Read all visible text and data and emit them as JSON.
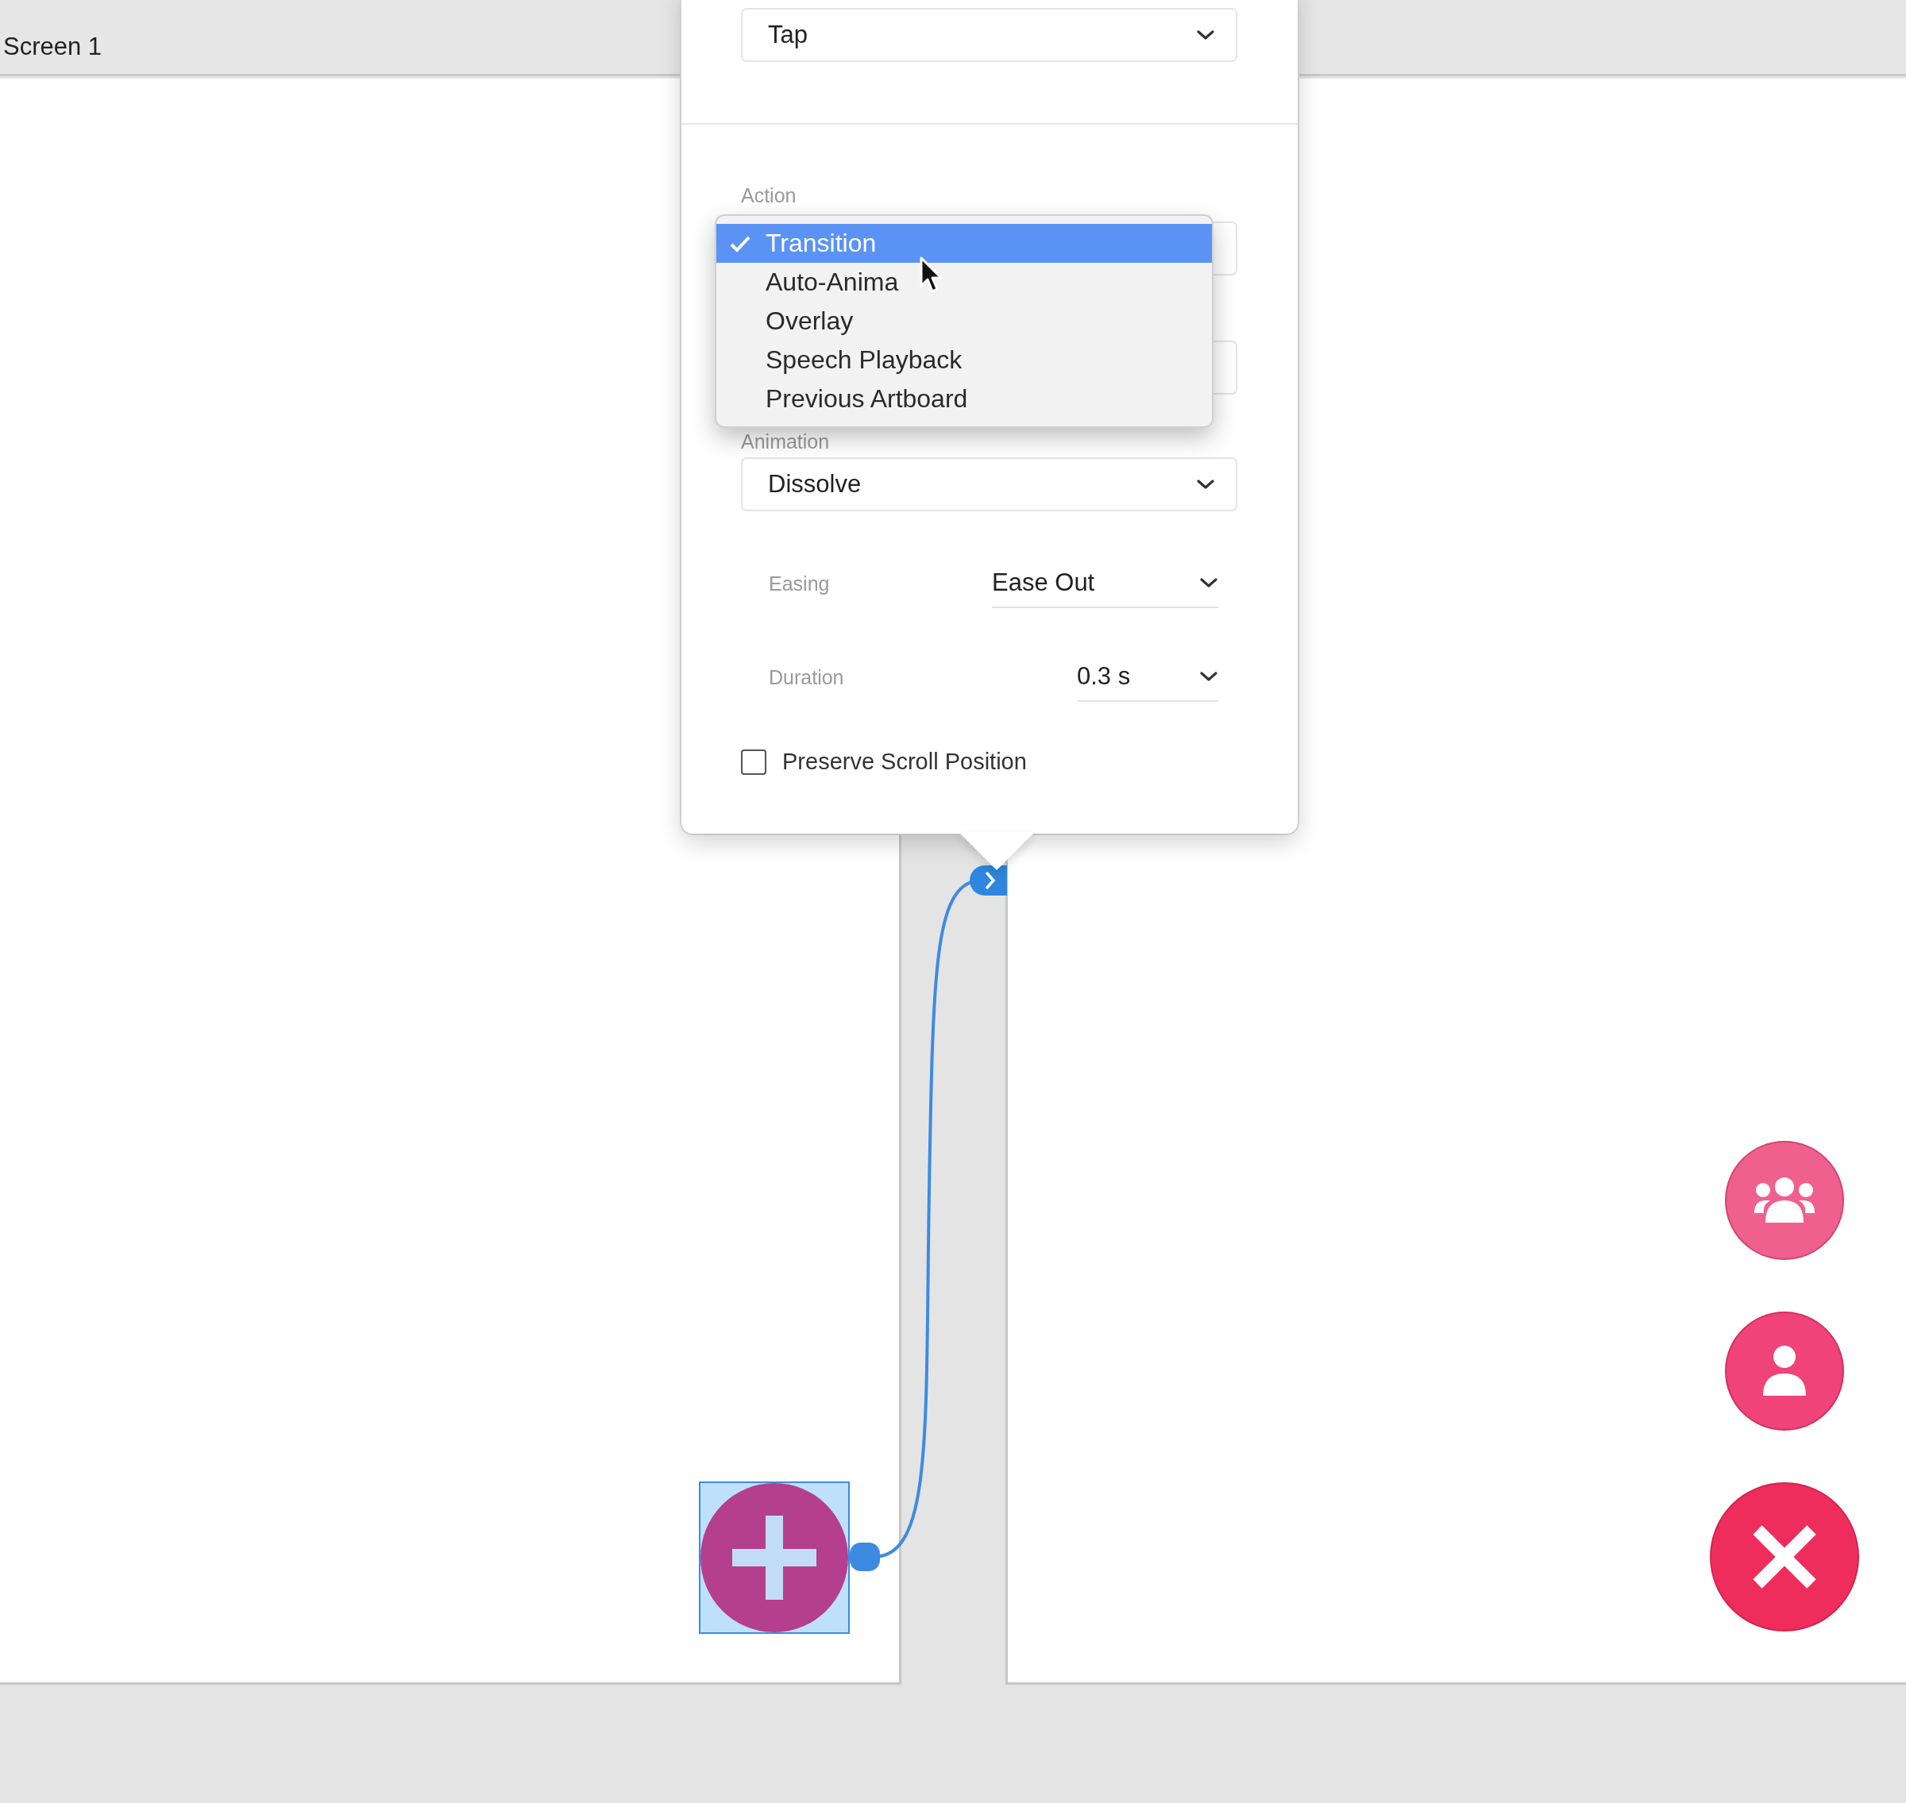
{
  "artboard": {
    "title": "Screen 1"
  },
  "interaction": {
    "trigger": {
      "value": "Tap"
    },
    "action": {
      "label": "Action",
      "menu": [
        {
          "label": "Transition",
          "selected": true
        },
        {
          "label": "Auto-Anima",
          "selected": false
        },
        {
          "label": "Overlay",
          "selected": false
        },
        {
          "label": "Speech Playback",
          "selected": false
        },
        {
          "label": "Previous Artboard",
          "selected": false
        }
      ]
    },
    "animation": {
      "label": "Animation",
      "value": "Dissolve"
    },
    "easing": {
      "label": "Easing",
      "value": "Ease Out"
    },
    "duration": {
      "label": "Duration",
      "value": "0.3 s"
    },
    "preserve_scroll": {
      "label": "Preserve Scroll Position",
      "checked": false
    }
  },
  "add_button": {
    "selected": true
  },
  "floating_buttons": [
    {
      "kind": "group"
    },
    {
      "kind": "person"
    },
    {
      "kind": "close"
    }
  ]
}
